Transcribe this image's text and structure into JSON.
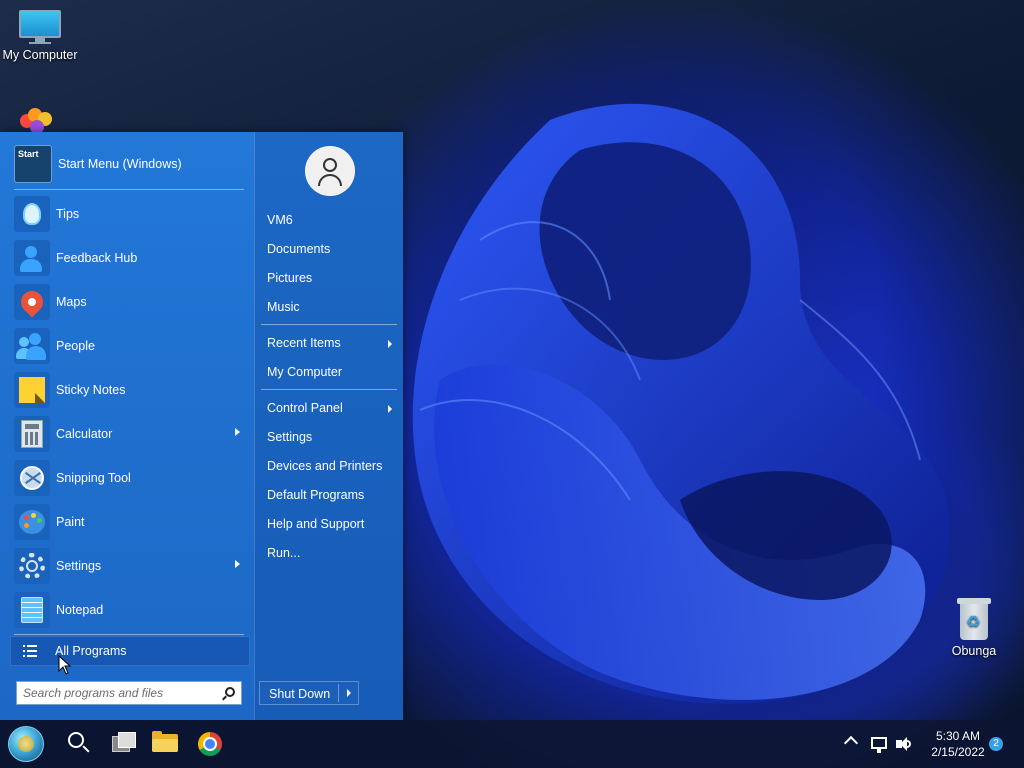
{
  "desktop": {
    "icons": [
      {
        "label": "My Computer",
        "icon": "monitor-icon"
      },
      {
        "label": "Obunga",
        "icon": "recycle-bin-icon"
      }
    ]
  },
  "start_menu": {
    "header_app": {
      "label": "Start Menu (Windows)",
      "icon_text": "Start"
    },
    "apps": [
      {
        "label": "Tips",
        "icon": "lightbulb-icon"
      },
      {
        "label": "Feedback Hub",
        "icon": "feedback-person-icon"
      },
      {
        "label": "Maps",
        "icon": "map-pin-icon"
      },
      {
        "label": "People",
        "icon": "people-icon"
      },
      {
        "label": "Sticky Notes",
        "icon": "sticky-note-icon"
      },
      {
        "label": "Calculator",
        "icon": "calculator-icon",
        "submenu": true
      },
      {
        "label": "Snipping Tool",
        "icon": "scissors-icon"
      },
      {
        "label": "Paint",
        "icon": "palette-icon"
      },
      {
        "label": "Settings",
        "icon": "gear-icon",
        "submenu": true
      },
      {
        "label": "Notepad",
        "icon": "notepad-icon"
      }
    ],
    "all_programs": "All Programs",
    "search_placeholder": "Search programs and files",
    "right": {
      "items": [
        {
          "label": "VM6"
        },
        {
          "label": "Documents"
        },
        {
          "label": "Pictures"
        },
        {
          "label": "Music"
        },
        {
          "label": "Recent Items",
          "submenu": true
        },
        {
          "label": "My Computer"
        },
        {
          "label": "Control Panel",
          "submenu": true
        },
        {
          "label": "Settings"
        },
        {
          "label": "Devices and Printers"
        },
        {
          "label": "Default Programs"
        },
        {
          "label": "Help and Support"
        },
        {
          "label": "Run..."
        }
      ],
      "shutdown": "Shut Down"
    }
  },
  "taskbar": {
    "apps": [
      "start-orb",
      "search-icon",
      "task-view-icon",
      "file-explorer-icon",
      "chrome-icon"
    ],
    "clock": {
      "time": "5:30 AM",
      "date": "2/15/2022"
    },
    "notifications": "2"
  },
  "colors": {
    "start_menu_blue": "#1f6fce",
    "all_programs_blue": "#1557b3",
    "taskbar": "#0c1632"
  }
}
